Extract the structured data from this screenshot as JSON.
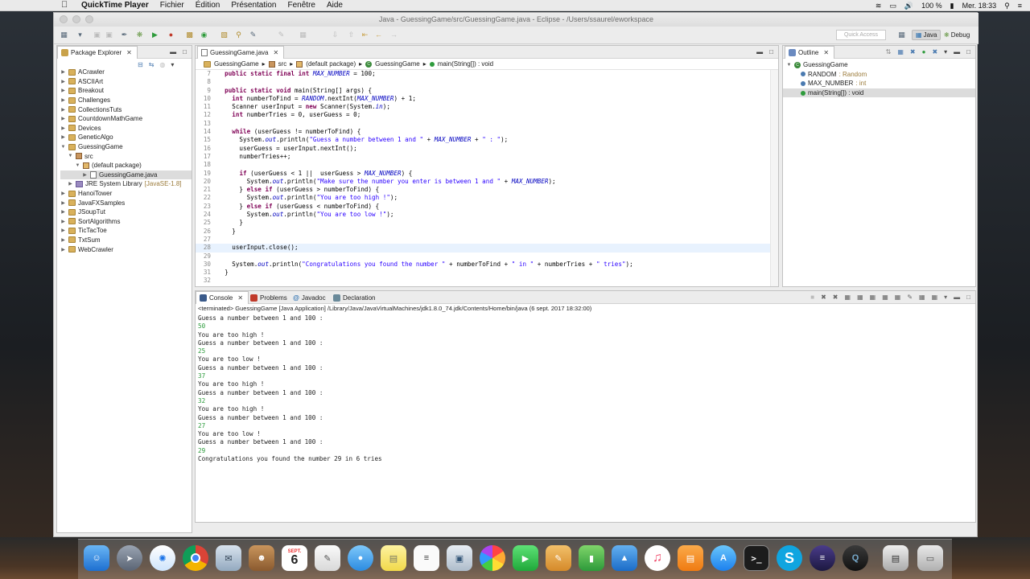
{
  "menubar": {
    "app": "QuickTime Player",
    "items": [
      "Fichier",
      "Édition",
      "Présentation",
      "Fenêtre",
      "Aide"
    ],
    "battery": "100 %",
    "clock": "Mer. 18:33"
  },
  "window": {
    "title": "Java - GuessingGame/src/GuessingGame.java - Eclipse - /Users/ssaurel/eworkspace"
  },
  "toolbar": {
    "quick_access": "Quick Access",
    "perspective_java": "Java",
    "perspective_debug": "Debug"
  },
  "package_explorer": {
    "tab": "Package Explorer",
    "items": [
      {
        "label": "ACrawler"
      },
      {
        "label": "ASCIIArt"
      },
      {
        "label": "Breakout"
      },
      {
        "label": "Challenges"
      },
      {
        "label": "CollectionsTuts"
      },
      {
        "label": "CountdownMathGame"
      },
      {
        "label": "Devices"
      },
      {
        "label": "GeneticAlgo"
      },
      {
        "label": "GuessingGame"
      },
      {
        "label": "src"
      },
      {
        "label": "(default package)"
      },
      {
        "label": "GuessingGame.java"
      },
      {
        "label": "JRE System Library",
        "extra": "[JavaSE-1.8]"
      },
      {
        "label": "HanoiTower"
      },
      {
        "label": "JavaFXSamples"
      },
      {
        "label": "JSoupTut"
      },
      {
        "label": "SortAlgorithms"
      },
      {
        "label": "TicTacToe"
      },
      {
        "label": "TxtSum"
      },
      {
        "label": "WebCrawler"
      }
    ]
  },
  "editor": {
    "tab": "GuessingGame.java",
    "breadcrumb": [
      "GuessingGame",
      "src",
      "(default package)",
      "GuessingGame",
      "main(String[]) : void"
    ],
    "lines": [
      {
        "n": "7",
        "t": "  public static final int MAX_NUMBER = 100;"
      },
      {
        "n": "8",
        "t": ""
      },
      {
        "n": "9",
        "t": "  public static void main(String[] args) {"
      },
      {
        "n": "10",
        "t": "    int numberToFind = RANDOM.nextInt(MAX_NUMBER) + 1;"
      },
      {
        "n": "11",
        "t": "    Scanner userInput = new Scanner(System.in);"
      },
      {
        "n": "12",
        "t": "    int numberTries = 0, userGuess = 0;"
      },
      {
        "n": "13",
        "t": ""
      },
      {
        "n": "14",
        "t": "    while (userGuess != numberToFind) {"
      },
      {
        "n": "15",
        "t": "      System.out.println(\"Guess a number between 1 and \" + MAX_NUMBER + \" : \");"
      },
      {
        "n": "16",
        "t": "      userGuess = userInput.nextInt();"
      },
      {
        "n": "17",
        "t": "      numberTries++;"
      },
      {
        "n": "18",
        "t": ""
      },
      {
        "n": "19",
        "t": "      if (userGuess < 1 ||  userGuess > MAX_NUMBER) {"
      },
      {
        "n": "20",
        "t": "        System.out.println(\"Make sure the number you enter is between 1 and \" + MAX_NUMBER);"
      },
      {
        "n": "21",
        "t": "      } else if (userGuess > numberToFind) {"
      },
      {
        "n": "22",
        "t": "        System.out.println(\"You are too high !\");"
      },
      {
        "n": "23",
        "t": "      } else if (userGuess < numberToFind) {"
      },
      {
        "n": "24",
        "t": "        System.out.println(\"You are too low !\");"
      },
      {
        "n": "25",
        "t": "      }"
      },
      {
        "n": "26",
        "t": "    }"
      },
      {
        "n": "27",
        "t": ""
      },
      {
        "n": "28",
        "t": "    userInput.close();"
      },
      {
        "n": "29",
        "t": ""
      },
      {
        "n": "30",
        "t": "    System.out.println(\"Congratulations you found the number \" + numberToFind + \" in \" + numberTries + \" tries\");"
      },
      {
        "n": "31",
        "t": "  }"
      },
      {
        "n": "32",
        "t": ""
      }
    ]
  },
  "outline": {
    "tab": "Outline",
    "items": [
      {
        "label": "GuessingGame",
        "type": ""
      },
      {
        "label": "RANDOM",
        "type": " : Random"
      },
      {
        "label": "MAX_NUMBER",
        "type": " : int"
      },
      {
        "label": "main(String[]) : void",
        "type": ""
      }
    ]
  },
  "bottom_tabs": {
    "console": "Console",
    "problems": "Problems",
    "javadoc": "Javadoc",
    "declaration": "Declaration"
  },
  "console": {
    "header": "<terminated> GuessingGame [Java Application] /Library/Java/JavaVirtualMachines/jdk1.8.0_74.jdk/Contents/Home/bin/java (6 sept. 2017 18:32:00)",
    "lines": [
      {
        "t": "Guess a number between 1 and 100 :",
        "input": false
      },
      {
        "t": "50",
        "input": true
      },
      {
        "t": "You are too high !",
        "input": false
      },
      {
        "t": "Guess a number between 1 and 100 :",
        "input": false
      },
      {
        "t": "25",
        "input": true
      },
      {
        "t": "You are too low !",
        "input": false
      },
      {
        "t": "Guess a number between 1 and 100 :",
        "input": false
      },
      {
        "t": "37",
        "input": true
      },
      {
        "t": "You are too high !",
        "input": false
      },
      {
        "t": "Guess a number between 1 and 100 :",
        "input": false
      },
      {
        "t": "32",
        "input": true
      },
      {
        "t": "You are too high !",
        "input": false
      },
      {
        "t": "Guess a number between 1 and 100 :",
        "input": false
      },
      {
        "t": "27",
        "input": true
      },
      {
        "t": "You are too low !",
        "input": false
      },
      {
        "t": "Guess a number between 1 and 100 :",
        "input": false
      },
      {
        "t": "29",
        "input": true
      },
      {
        "t": "Congratulations you found the number 29 in 6 tries",
        "input": false
      }
    ]
  },
  "dock": {
    "calendar_month": "SEPT.",
    "calendar_day": "6"
  }
}
